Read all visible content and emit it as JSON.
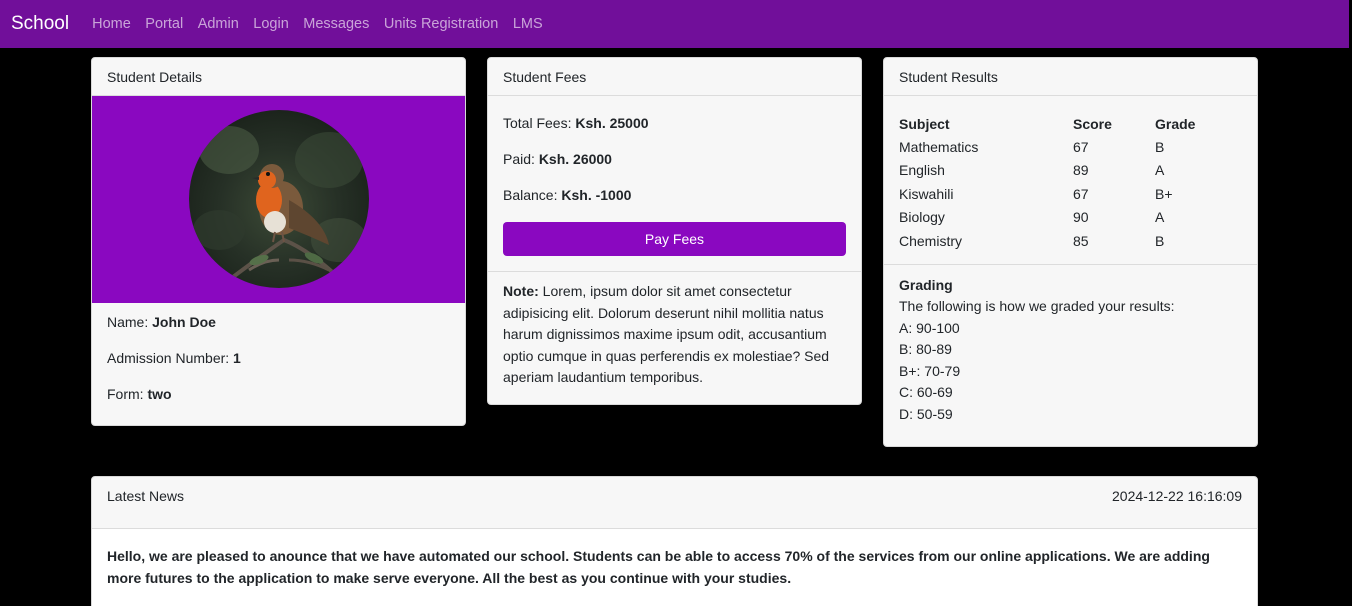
{
  "navbar": {
    "brand": "School",
    "links": [
      "Home",
      "Portal",
      "Admin",
      "Login",
      "Messages",
      "Units Registration",
      "LMS"
    ]
  },
  "student_details": {
    "title": "Student Details",
    "photo_icon": "robin-bird-photo",
    "name_label": "Name:",
    "name_value": "John Doe",
    "admission_label": "Admission Number:",
    "admission_value": "1",
    "form_label": "Form:",
    "form_value": "two"
  },
  "student_fees": {
    "title": "Student Fees",
    "total_label": "Total Fees:",
    "total_value": "Ksh. 25000",
    "paid_label": "Paid:",
    "paid_value": "Ksh. 26000",
    "balance_label": "Balance:",
    "balance_value": "Ksh. -1000",
    "pay_button": "Pay Fees",
    "note_label": "Note:",
    "note_text": "Lorem, ipsum dolor sit amet consectetur adipisicing elit. Dolorum deserunt nihil mollitia natus harum dignissimos maxime ipsum odit, accusantium optio cumque in quas perferendis ex molestiae? Sed aperiam laudantium temporibus."
  },
  "student_results": {
    "title": "Student Results",
    "headers": [
      "Subject",
      "Score",
      "Grade"
    ],
    "rows": [
      [
        "Mathematics",
        "67",
        "B"
      ],
      [
        "English",
        "89",
        "A"
      ],
      [
        "Kiswahili",
        "67",
        "B+"
      ],
      [
        "Biology",
        "90",
        "A"
      ],
      [
        "Chemistry",
        "85",
        "B"
      ]
    ],
    "grading_title": "Grading",
    "grading_intro": "The following is how we graded your results:",
    "grading_scale": [
      "A: 90-100",
      "B: 80-89",
      "B+: 70-79",
      "C: 60-69",
      "D: 50-59"
    ]
  },
  "news": {
    "title": "Latest News",
    "timestamp": "2024-12-22 16:16:09",
    "body": "Hello, we are pleased to anounce that we have automated our school. Students can be able to access 70% of the services from our online applications. We are adding more futures to the application to make serve everyone. All the best as you continue with your studies."
  },
  "colors": {
    "navbar": "#710f9a",
    "accent": "#8a08c0",
    "background": "#000000",
    "card": "#f7f7f7"
  }
}
